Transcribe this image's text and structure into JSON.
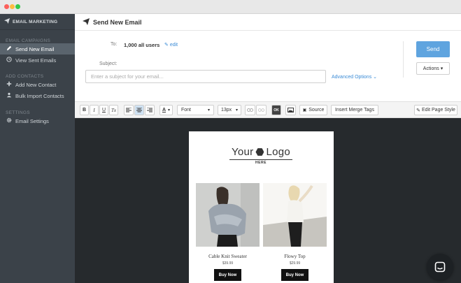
{
  "sidebar": {
    "brand": "EMAIL MARKETING",
    "sections": [
      {
        "title": "EMAIL CAMPAIGNS",
        "items": [
          {
            "label": "Send New Email",
            "icon": "pencil-icon",
            "active": true
          },
          {
            "label": "View Sent Emails",
            "icon": "clock-icon",
            "active": false
          }
        ]
      },
      {
        "title": "ADD CONTACTS",
        "items": [
          {
            "label": "Add New Contact",
            "icon": "plus-icon",
            "active": false
          },
          {
            "label": "Bulk Import Contacts",
            "icon": "import-icon",
            "active": false
          }
        ]
      },
      {
        "title": "SETTINGS",
        "items": [
          {
            "label": "Email Settings",
            "icon": "gear-icon",
            "active": false
          }
        ]
      }
    ]
  },
  "header": {
    "title": "Send New Email",
    "icon": "paper-plane-icon"
  },
  "compose": {
    "to_label": "To:",
    "to_value": "1,000 all users",
    "edit_label": "edit",
    "subject_label": "Subject:",
    "subject_placeholder": "Enter a subject for your email...",
    "subject_value": "",
    "advanced_label": "Advanced Options",
    "send_label": "Send",
    "actions_label": "Actions"
  },
  "toolbar": {
    "bold": "B",
    "italic": "I",
    "underline": "U",
    "clear_format": "Tx",
    "font_label": "Font",
    "size_label": "13px",
    "dark_label": "OK",
    "source_label": "Source",
    "merge_label": "Insert Merge Tags",
    "page_style_label": "Edit Page Style"
  },
  "email": {
    "logo_left": "Your",
    "logo_right": "Logo",
    "logo_sub": "HERE",
    "products": [
      {
        "name": "Cable Knit Sweater",
        "price": "$39.99",
        "button": "Buy Now"
      },
      {
        "name": "Flowy Top",
        "price": "$29.99",
        "button": "Buy Now"
      }
    ]
  },
  "colors": {
    "sidebar_bg": "#3b4249",
    "active_item": "#5a646d",
    "accent_blue": "#5fa4df",
    "link_blue": "#3a8bd6",
    "canvas_bg": "#262a2d"
  }
}
